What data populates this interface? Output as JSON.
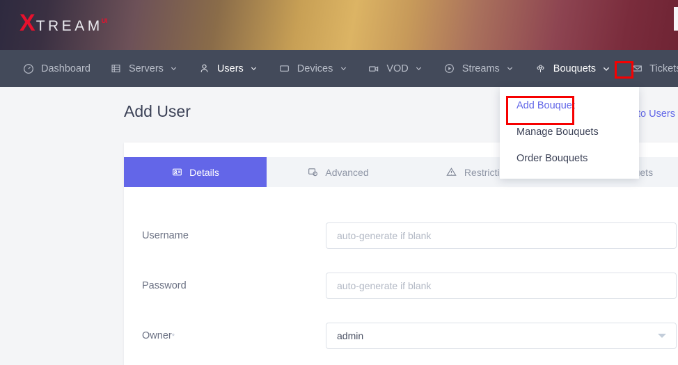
{
  "brand": {
    "logo_x": "X",
    "logo_rest": "TREAM",
    "logo_sup": "UI"
  },
  "nav": {
    "items": [
      {
        "label": "Dashboard",
        "icon": "gauge-icon",
        "caret": false,
        "active": false
      },
      {
        "label": "Servers",
        "icon": "server-icon",
        "caret": true,
        "active": false
      },
      {
        "label": "Users",
        "icon": "user-icon",
        "caret": true,
        "active": true
      },
      {
        "label": "Devices",
        "icon": "device-icon",
        "caret": true,
        "active": false
      },
      {
        "label": "VOD",
        "icon": "video-icon",
        "caret": true,
        "active": false
      },
      {
        "label": "Streams",
        "icon": "play-icon",
        "caret": true,
        "active": false
      },
      {
        "label": "Bouquets",
        "icon": "flower-icon",
        "caret": true,
        "active": true
      },
      {
        "label": "Tickets",
        "icon": "mail-icon",
        "caret": false,
        "active": false
      }
    ]
  },
  "dropdown": {
    "items": [
      {
        "label": "Add Bouquet",
        "highlighted": true
      },
      {
        "label": "Manage Bouquets",
        "highlighted": false
      },
      {
        "label": "Order Bouquets",
        "highlighted": false
      }
    ]
  },
  "page": {
    "title": "Add User",
    "back_link": "Back to Users"
  },
  "tabs": [
    {
      "label": "Details",
      "icon": "id-card-icon",
      "active": true
    },
    {
      "label": "Advanced",
      "icon": "settings-icon",
      "active": false
    },
    {
      "label": "Restrictions",
      "icon": "warning-icon",
      "active": false
    },
    {
      "label": "Bouquets",
      "icon": "flower-icon",
      "active": false
    }
  ],
  "form": {
    "fields": [
      {
        "label": "Username",
        "value": "",
        "placeholder": "auto-generate if blank",
        "type": "text",
        "required": false
      },
      {
        "label": "Password",
        "value": "",
        "placeholder": "auto-generate if blank",
        "type": "text",
        "required": false
      },
      {
        "label": "Owner",
        "value": "admin",
        "placeholder": "",
        "type": "select",
        "required": true
      }
    ]
  },
  "colors": {
    "accent": "#6366e8",
    "nav_bg": "#434a5a",
    "highlight_box": "#f60000",
    "link": "#6166e8",
    "logo_red": "#e8112d"
  }
}
